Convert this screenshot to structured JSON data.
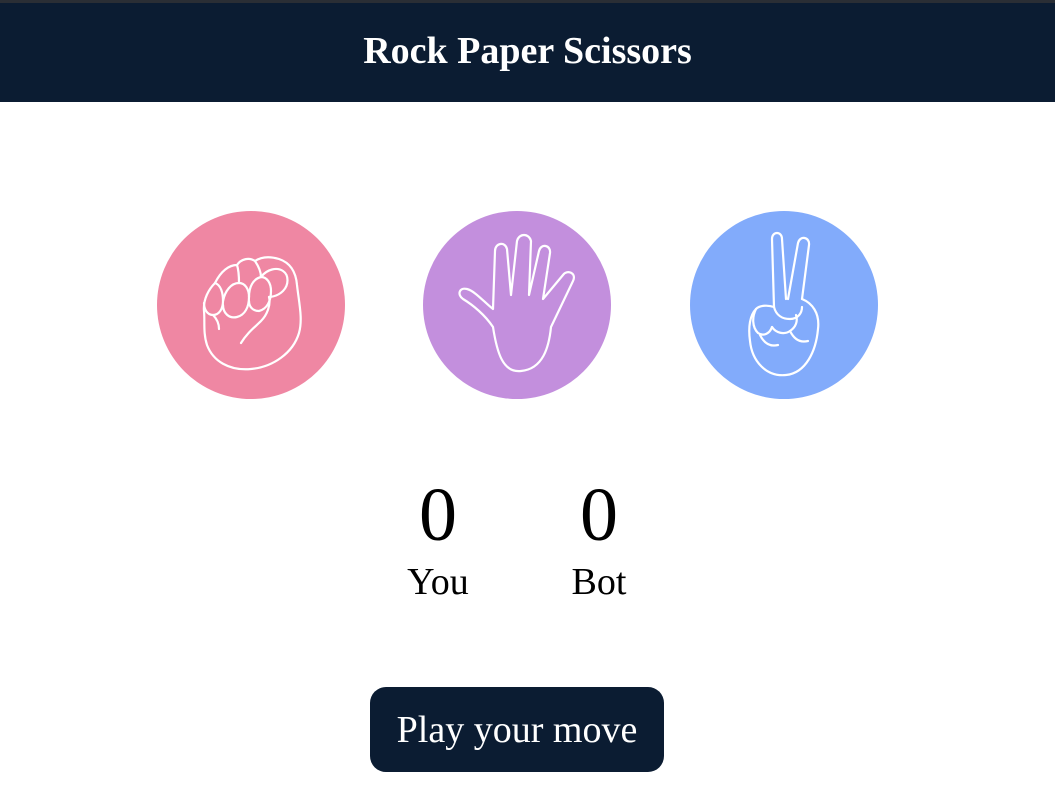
{
  "header": {
    "title": "Rock Paper Scissors"
  },
  "choices": [
    {
      "id": "rock",
      "icon": "fist-icon",
      "color": "#ef87a3"
    },
    {
      "id": "paper",
      "icon": "open-hand-icon",
      "color": "#c38fdd"
    },
    {
      "id": "scissors",
      "icon": "peace-sign-icon",
      "color": "#82abfb"
    }
  ],
  "scoreboard": {
    "you": {
      "score": "0",
      "label": "You"
    },
    "bot": {
      "score": "0",
      "label": "Bot"
    }
  },
  "play_button": {
    "label": "Play your move"
  },
  "colors": {
    "header_bg": "#0b1c32",
    "button_bg": "#0b1c32",
    "text_light": "#ffffff"
  }
}
